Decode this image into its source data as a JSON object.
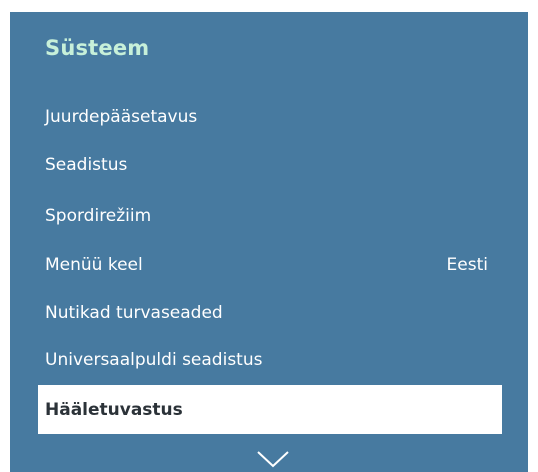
{
  "menu": {
    "title": "Süsteem",
    "items": [
      {
        "label": "Juurdepääsetavus",
        "value": ""
      },
      {
        "label": "Seadistus",
        "value": ""
      },
      {
        "label": "Spordirežiim",
        "value": ""
      },
      {
        "label": "Menüü keel",
        "value": "Eesti"
      },
      {
        "label": "Nutikad turvaseaded",
        "value": ""
      },
      {
        "label": "Universaalpuldi seadistus",
        "value": ""
      },
      {
        "label": "Hääletuvastus",
        "value": ""
      }
    ],
    "selected_index": 6,
    "more_icon": "chevron-down-icon"
  }
}
